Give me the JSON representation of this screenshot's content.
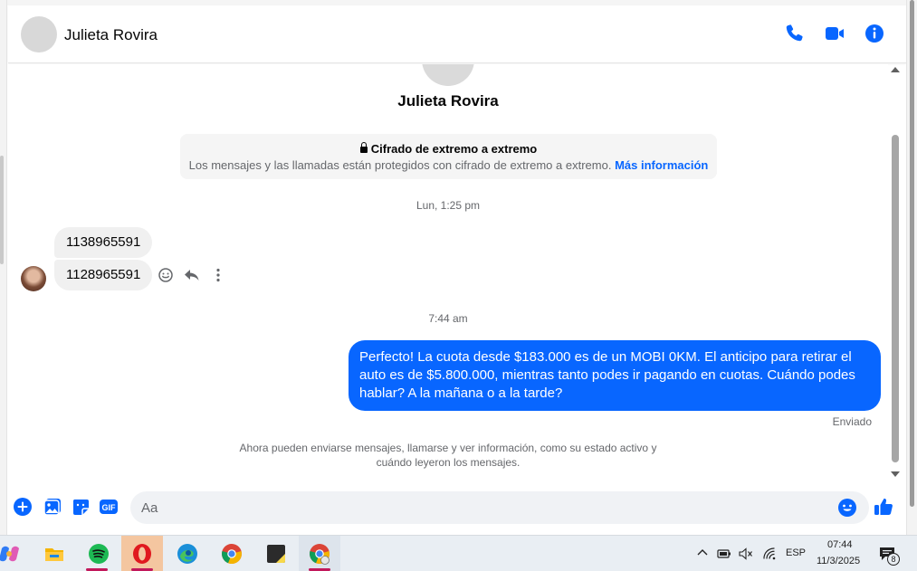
{
  "header": {
    "contact_name": "Julieta Rovira",
    "icons": [
      "phone-icon",
      "video-call-icon",
      "info-icon"
    ],
    "accent_color": "#0866ff"
  },
  "profile": {
    "name": "Julieta Rovira"
  },
  "encryption": {
    "title": "Cifrado de extremo a extremo",
    "description": "Los mensajes y las llamadas están protegidos con cifrado de extremo a extremo.",
    "link": "Más información"
  },
  "messages": {
    "timestamp_1": "Lun, 1:25 pm",
    "incoming": [
      "1138965591",
      "1128965591"
    ],
    "timestamp_2": "7:44 am",
    "outgoing": "Perfecto! La cuota desde $183.000 es de un MOBI 0KM. El anticipo para retirar el auto es de $5.800.000, mientras tanto podes ir pagando en cuotas. Cuándo podes hablar? A la mañana o a la tarde?",
    "outgoing_status": "Enviado",
    "info_note": "Ahora pueden enviarse mensajes, llamarse y ver información, como su estado activo y cuándo leyeron los mensajes."
  },
  "composer": {
    "placeholder": "Aa",
    "gif_label": "GIF"
  },
  "taskbar": {
    "apps": [
      "copilot",
      "file-explorer",
      "spotify",
      "opera",
      "edge",
      "chrome",
      "sticky-notes",
      "chrome-profile"
    ],
    "language": "ESP",
    "time": "07:44",
    "date": "11/3/2025",
    "notification_count": "8"
  }
}
